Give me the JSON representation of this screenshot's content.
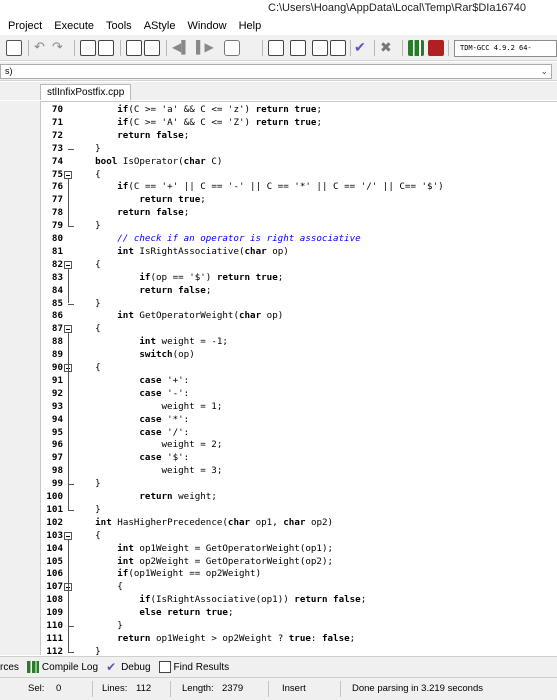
{
  "window": {
    "title": "C:\\Users\\Hoang\\AppData\\Local\\Temp\\Rar$DIa16740"
  },
  "menu": [
    "Project",
    "Execute",
    "Tools",
    "AStyle",
    "Window",
    "Help"
  ],
  "toolbar": {
    "compiler": "TDM-GCC 4.9.2 64-"
  },
  "classbar": {
    "value": "s)"
  },
  "editor": {
    "tab": "stlInfixPostfix.cpp",
    "lines": [
      {
        "n": "70",
        "code": "        if(C >= 'a' && C <= 'z') return true;"
      },
      {
        "n": "71",
        "code": "        if(C >= 'A' && C <= 'Z') return true;"
      },
      {
        "n": "72",
        "code": "        return false;"
      },
      {
        "n": "73",
        "code": "    }"
      },
      {
        "n": "74",
        "code": "    bool IsOperator(char C)"
      },
      {
        "n": "75",
        "code": "    {"
      },
      {
        "n": "76",
        "code": "        if(C == '+' || C == '-' || C == '*' || C == '/' || C== '$')"
      },
      {
        "n": "77",
        "code": "            return true;"
      },
      {
        "n": "78",
        "code": "        return false;"
      },
      {
        "n": "79",
        "code": "    }"
      },
      {
        "n": "80",
        "code": "        // check if an operator is right associative",
        "comment": true
      },
      {
        "n": "81",
        "code": "        int IsRightAssociative(char op)"
      },
      {
        "n": "82",
        "code": "    {"
      },
      {
        "n": "83",
        "code": "            if(op == '$') return true;"
      },
      {
        "n": "84",
        "code": "            return false;"
      },
      {
        "n": "85",
        "code": "    }"
      },
      {
        "n": "86",
        "code": "        int GetOperatorWeight(char op)"
      },
      {
        "n": "87",
        "code": "    {"
      },
      {
        "n": "88",
        "code": "            int weight = -1;"
      },
      {
        "n": "89",
        "code": "            switch(op)"
      },
      {
        "n": "90",
        "code": "    {"
      },
      {
        "n": "91",
        "code": "            case '+':"
      },
      {
        "n": "92",
        "code": "            case '-':"
      },
      {
        "n": "93",
        "code": "                weight = 1;"
      },
      {
        "n": "94",
        "code": "            case '*':"
      },
      {
        "n": "95",
        "code": "            case '/':"
      },
      {
        "n": "96",
        "code": "                weight = 2;"
      },
      {
        "n": "97",
        "code": "            case '$':"
      },
      {
        "n": "98",
        "code": "                weight = 3;"
      },
      {
        "n": "99",
        "code": "    }"
      },
      {
        "n": "100",
        "code": "            return weight;"
      },
      {
        "n": "101",
        "code": "    }"
      },
      {
        "n": "102",
        "code": "    int HasHigherPrecedence(char op1, char op2)"
      },
      {
        "n": "103",
        "code": "    {"
      },
      {
        "n": "104",
        "code": "        int op1Weight = GetOperatorWeight(op1);"
      },
      {
        "n": "105",
        "code": "        int op2Weight = GetOperatorWeight(op2);"
      },
      {
        "n": "106",
        "code": "        if(op1Weight == op2Weight)"
      },
      {
        "n": "107",
        "code": "        {"
      },
      {
        "n": "108",
        "code": "            if(IsRightAssociative(op1)) return false;"
      },
      {
        "n": "109",
        "code": "            else return true;"
      },
      {
        "n": "110",
        "code": "        }"
      },
      {
        "n": "111",
        "code": "        return op1Weight > op2Weight ? true: false;"
      },
      {
        "n": "112",
        "code": "    }"
      }
    ]
  },
  "bottom_tabs": [
    {
      "label": "rces",
      "icon": ""
    },
    {
      "label": "Compile Log",
      "icon": "compile-log-icon"
    },
    {
      "label": "Debug",
      "icon": "debug-check-icon"
    },
    {
      "label": "Find Results",
      "icon": "find-results-icon"
    }
  ],
  "status": {
    "sel_label": "Sel:",
    "sel_value": "0",
    "lines_label": "Lines:",
    "lines_value": "112",
    "length_label": "Length:",
    "length_value": "2379",
    "mode": "Insert",
    "message": "Done parsing in 3.219 seconds"
  }
}
